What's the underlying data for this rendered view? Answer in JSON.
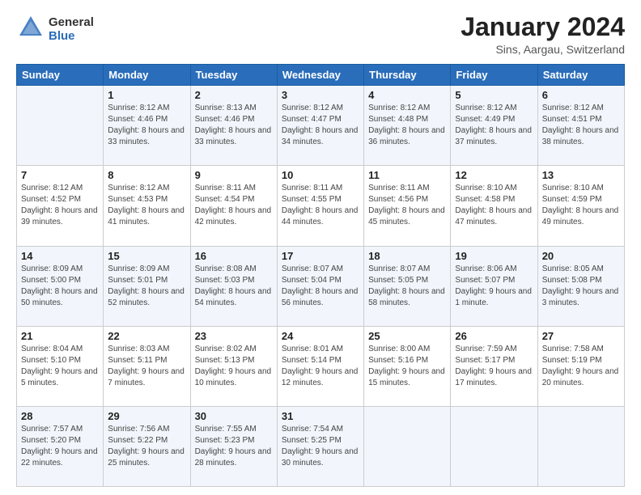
{
  "logo": {
    "general": "General",
    "blue": "Blue"
  },
  "header": {
    "title": "January 2024",
    "subtitle": "Sins, Aargau, Switzerland"
  },
  "weekdays": [
    "Sunday",
    "Monday",
    "Tuesday",
    "Wednesday",
    "Thursday",
    "Friday",
    "Saturday"
  ],
  "weeks": [
    [
      {
        "day": "",
        "sunrise": "",
        "sunset": "",
        "daylight": ""
      },
      {
        "day": "1",
        "sunrise": "Sunrise: 8:12 AM",
        "sunset": "Sunset: 4:46 PM",
        "daylight": "Daylight: 8 hours and 33 minutes."
      },
      {
        "day": "2",
        "sunrise": "Sunrise: 8:13 AM",
        "sunset": "Sunset: 4:46 PM",
        "daylight": "Daylight: 8 hours and 33 minutes."
      },
      {
        "day": "3",
        "sunrise": "Sunrise: 8:12 AM",
        "sunset": "Sunset: 4:47 PM",
        "daylight": "Daylight: 8 hours and 34 minutes."
      },
      {
        "day": "4",
        "sunrise": "Sunrise: 8:12 AM",
        "sunset": "Sunset: 4:48 PM",
        "daylight": "Daylight: 8 hours and 36 minutes."
      },
      {
        "day": "5",
        "sunrise": "Sunrise: 8:12 AM",
        "sunset": "Sunset: 4:49 PM",
        "daylight": "Daylight: 8 hours and 37 minutes."
      },
      {
        "day": "6",
        "sunrise": "Sunrise: 8:12 AM",
        "sunset": "Sunset: 4:51 PM",
        "daylight": "Daylight: 8 hours and 38 minutes."
      }
    ],
    [
      {
        "day": "7",
        "sunrise": "Sunrise: 8:12 AM",
        "sunset": "Sunset: 4:52 PM",
        "daylight": "Daylight: 8 hours and 39 minutes."
      },
      {
        "day": "8",
        "sunrise": "Sunrise: 8:12 AM",
        "sunset": "Sunset: 4:53 PM",
        "daylight": "Daylight: 8 hours and 41 minutes."
      },
      {
        "day": "9",
        "sunrise": "Sunrise: 8:11 AM",
        "sunset": "Sunset: 4:54 PM",
        "daylight": "Daylight: 8 hours and 42 minutes."
      },
      {
        "day": "10",
        "sunrise": "Sunrise: 8:11 AM",
        "sunset": "Sunset: 4:55 PM",
        "daylight": "Daylight: 8 hours and 44 minutes."
      },
      {
        "day": "11",
        "sunrise": "Sunrise: 8:11 AM",
        "sunset": "Sunset: 4:56 PM",
        "daylight": "Daylight: 8 hours and 45 minutes."
      },
      {
        "day": "12",
        "sunrise": "Sunrise: 8:10 AM",
        "sunset": "Sunset: 4:58 PM",
        "daylight": "Daylight: 8 hours and 47 minutes."
      },
      {
        "day": "13",
        "sunrise": "Sunrise: 8:10 AM",
        "sunset": "Sunset: 4:59 PM",
        "daylight": "Daylight: 8 hours and 49 minutes."
      }
    ],
    [
      {
        "day": "14",
        "sunrise": "Sunrise: 8:09 AM",
        "sunset": "Sunset: 5:00 PM",
        "daylight": "Daylight: 8 hours and 50 minutes."
      },
      {
        "day": "15",
        "sunrise": "Sunrise: 8:09 AM",
        "sunset": "Sunset: 5:01 PM",
        "daylight": "Daylight: 8 hours and 52 minutes."
      },
      {
        "day": "16",
        "sunrise": "Sunrise: 8:08 AM",
        "sunset": "Sunset: 5:03 PM",
        "daylight": "Daylight: 8 hours and 54 minutes."
      },
      {
        "day": "17",
        "sunrise": "Sunrise: 8:07 AM",
        "sunset": "Sunset: 5:04 PM",
        "daylight": "Daylight: 8 hours and 56 minutes."
      },
      {
        "day": "18",
        "sunrise": "Sunrise: 8:07 AM",
        "sunset": "Sunset: 5:05 PM",
        "daylight": "Daylight: 8 hours and 58 minutes."
      },
      {
        "day": "19",
        "sunrise": "Sunrise: 8:06 AM",
        "sunset": "Sunset: 5:07 PM",
        "daylight": "Daylight: 9 hours and 1 minute."
      },
      {
        "day": "20",
        "sunrise": "Sunrise: 8:05 AM",
        "sunset": "Sunset: 5:08 PM",
        "daylight": "Daylight: 9 hours and 3 minutes."
      }
    ],
    [
      {
        "day": "21",
        "sunrise": "Sunrise: 8:04 AM",
        "sunset": "Sunset: 5:10 PM",
        "daylight": "Daylight: 9 hours and 5 minutes."
      },
      {
        "day": "22",
        "sunrise": "Sunrise: 8:03 AM",
        "sunset": "Sunset: 5:11 PM",
        "daylight": "Daylight: 9 hours and 7 minutes."
      },
      {
        "day": "23",
        "sunrise": "Sunrise: 8:02 AM",
        "sunset": "Sunset: 5:13 PM",
        "daylight": "Daylight: 9 hours and 10 minutes."
      },
      {
        "day": "24",
        "sunrise": "Sunrise: 8:01 AM",
        "sunset": "Sunset: 5:14 PM",
        "daylight": "Daylight: 9 hours and 12 minutes."
      },
      {
        "day": "25",
        "sunrise": "Sunrise: 8:00 AM",
        "sunset": "Sunset: 5:16 PM",
        "daylight": "Daylight: 9 hours and 15 minutes."
      },
      {
        "day": "26",
        "sunrise": "Sunrise: 7:59 AM",
        "sunset": "Sunset: 5:17 PM",
        "daylight": "Daylight: 9 hours and 17 minutes."
      },
      {
        "day": "27",
        "sunrise": "Sunrise: 7:58 AM",
        "sunset": "Sunset: 5:19 PM",
        "daylight": "Daylight: 9 hours and 20 minutes."
      }
    ],
    [
      {
        "day": "28",
        "sunrise": "Sunrise: 7:57 AM",
        "sunset": "Sunset: 5:20 PM",
        "daylight": "Daylight: 9 hours and 22 minutes."
      },
      {
        "day": "29",
        "sunrise": "Sunrise: 7:56 AM",
        "sunset": "Sunset: 5:22 PM",
        "daylight": "Daylight: 9 hours and 25 minutes."
      },
      {
        "day": "30",
        "sunrise": "Sunrise: 7:55 AM",
        "sunset": "Sunset: 5:23 PM",
        "daylight": "Daylight: 9 hours and 28 minutes."
      },
      {
        "day": "31",
        "sunrise": "Sunrise: 7:54 AM",
        "sunset": "Sunset: 5:25 PM",
        "daylight": "Daylight: 9 hours and 30 minutes."
      },
      {
        "day": "",
        "sunrise": "",
        "sunset": "",
        "daylight": ""
      },
      {
        "day": "",
        "sunrise": "",
        "sunset": "",
        "daylight": ""
      },
      {
        "day": "",
        "sunrise": "",
        "sunset": "",
        "daylight": ""
      }
    ]
  ]
}
